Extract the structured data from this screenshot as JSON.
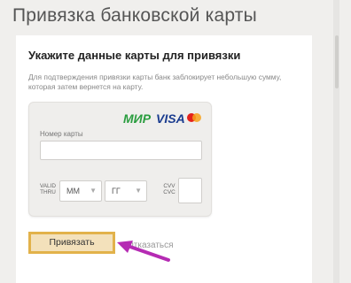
{
  "page": {
    "title": "Привязка банковской карты"
  },
  "form": {
    "heading": "Укажите данные карты для привязки",
    "description": "Для подтверждения привязки карты банк заблокирует небольшую сумму, которая затем вернется на карту."
  },
  "card": {
    "brands": {
      "mir": "МИР",
      "visa": "VISA",
      "mastercard_icon": "mastercard-icon"
    },
    "number_label": "Номер карты",
    "number_value": "",
    "valid_thru_label": "VALID THRU",
    "month": {
      "selected": "ММ",
      "arrow_icon": "chevron-down-icon"
    },
    "year": {
      "selected": "ГГ",
      "arrow_icon": "chevron-down-icon"
    },
    "cvv_label": "CVV CVC",
    "cvv_value": ""
  },
  "actions": {
    "bind_label": "Привязать",
    "cancel_label": "Отказаться"
  },
  "colors": {
    "page_bg": "#f0efed",
    "button_border": "#e2b24a",
    "button_bg": "#f3e1bb",
    "annotation_arrow": "#b52bb3",
    "mir_green": "#2a9d3f",
    "visa_blue": "#1a3c8f"
  }
}
